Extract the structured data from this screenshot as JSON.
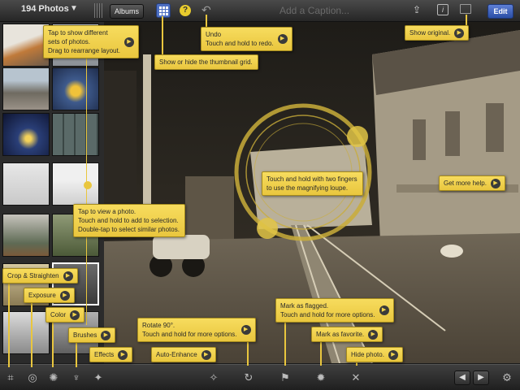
{
  "topbar": {
    "photo_count": "194 Photos",
    "albums_label": "Albums",
    "help_label": "?",
    "caption_placeholder": "Add a Caption...",
    "info_label": "i",
    "edit_label": "Edit"
  },
  "tips": {
    "thumbs_layout": [
      "Tap to show different",
      "sets of photos.",
      "Drag to rearrange layout."
    ],
    "grid": [
      "Show or hide the thumbnail grid."
    ],
    "undo": [
      "Undo",
      "Touch and hold to redo."
    ],
    "original": [
      "Show original."
    ],
    "loupe": [
      "Touch and hold with two fingers",
      "to use the magnifying loupe."
    ],
    "help": [
      "Get more help."
    ],
    "view_photo": [
      "Tap to view a photo.",
      "Touch and hold to add to selection.",
      "Double-tap to select similar photos."
    ],
    "crop": [
      "Crop & Straighten"
    ],
    "exposure": [
      "Exposure"
    ],
    "color": [
      "Color"
    ],
    "brushes": [
      "Brushes"
    ],
    "effects": [
      "Effects"
    ],
    "auto_enhance": [
      "Auto-Enhance"
    ],
    "rotate": [
      "Rotate 90°.",
      "Touch and hold for more options."
    ],
    "flag": [
      "Mark as flagged.",
      "Touch and hold for more options."
    ],
    "favorite": [
      "Mark as favorite."
    ],
    "hide": [
      "Hide photo."
    ]
  },
  "colors": {
    "tip_yellow": "#f1d34c",
    "accent_blue": "#4d6fc2",
    "toolbar_dark": "#262626"
  },
  "icons": {
    "crop": "crop-icon",
    "exposure": "exposure-icon",
    "color": "palette-icon",
    "brushes": "brush-icon",
    "effects": "effects-icon",
    "auto_enhance": "magic-wand-icon",
    "rotate": "rotate-icon",
    "flag": "flag-icon",
    "favorite": "favorite-icon",
    "hide": "close-icon",
    "prev": "arrow-left-icon",
    "next": "arrow-right-icon",
    "settings": "gear-icon"
  }
}
